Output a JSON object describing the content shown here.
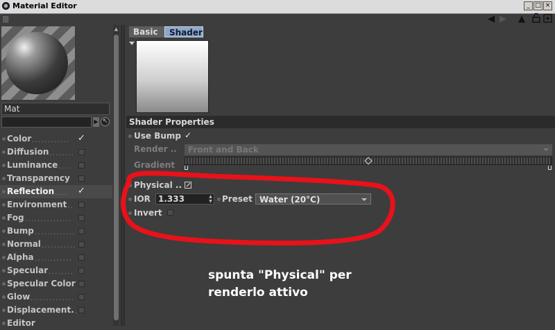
{
  "window": {
    "title": "Material Editor",
    "controls": {
      "minimize": "_",
      "maximize": "□",
      "close": "×"
    }
  },
  "toolbar": {
    "icons": [
      "arrow-left-icon",
      "arrow-right-icon",
      "arrow-up-icon",
      "lock-icon",
      "new-window-icon"
    ],
    "back_glyph": "◀",
    "forward_glyph": "◀",
    "up_glyph": "▲",
    "lock_glyph": "🔓",
    "new_glyph": "⊞"
  },
  "material": {
    "name": "Mat"
  },
  "channels": [
    {
      "label": "Color",
      "leader": "............",
      "enabled": true,
      "selected": false
    },
    {
      "label": "Diffusion",
      "leader": "........",
      "enabled": false,
      "selected": false
    },
    {
      "label": "Luminance",
      "leader": "....",
      "enabled": false,
      "selected": false
    },
    {
      "label": "Transparency",
      "leader": "",
      "enabled": false,
      "selected": false
    },
    {
      "label": "Reflection",
      "leader": "....",
      "enabled": true,
      "selected": true
    },
    {
      "label": "Environment",
      "leader": "..",
      "enabled": false,
      "selected": false
    },
    {
      "label": "Fog",
      "leader": "...............",
      "enabled": false,
      "selected": false
    },
    {
      "label": "Bump",
      "leader": ".............",
      "enabled": false,
      "selected": false
    },
    {
      "label": "Normal",
      "leader": "...........",
      "enabled": false,
      "selected": false
    },
    {
      "label": "Alpha",
      "leader": "............",
      "enabled": false,
      "selected": false
    },
    {
      "label": "Specular",
      "leader": "........",
      "enabled": false,
      "selected": false
    },
    {
      "label": "Specular Color",
      "leader": "",
      "enabled": false,
      "selected": false
    },
    {
      "label": "Glow",
      "leader": "..............",
      "enabled": false,
      "selected": false
    },
    {
      "label": "Displacement.",
      "leader": ".",
      "enabled": false,
      "selected": false
    },
    {
      "label": "Editor",
      "leader": "",
      "enabled": false,
      "selected": false
    }
  ],
  "tabs": [
    {
      "label": "Basic",
      "active": false
    },
    {
      "label": "Shader",
      "active": true
    }
  ],
  "shader_properties": {
    "header": "Shader Properties",
    "use_bump": {
      "label": "Use Bump",
      "checked": true,
      "check_glyph": "✓"
    },
    "render": {
      "label": "Render ..",
      "value": "Front and Back",
      "disabled": true
    },
    "gradient": {
      "label": "Gradient"
    },
    "physical": {
      "label": "Physical ..",
      "checked": true
    },
    "ior": {
      "label": "IOR",
      "value": "1.333"
    },
    "preset": {
      "label": "Preset",
      "value": "Water (20°C)"
    },
    "invert": {
      "label": "Invert",
      "checked": false
    }
  },
  "annotation": {
    "line1": "spunta \"Physical\" per",
    "line2": "renderlo attivo",
    "ellipse_color": "#e8121a"
  },
  "colors": {
    "panel_bg": "#3d3d3d",
    "active_tab": "#8ea7c8",
    "titlebar": "#dcdcdc"
  }
}
